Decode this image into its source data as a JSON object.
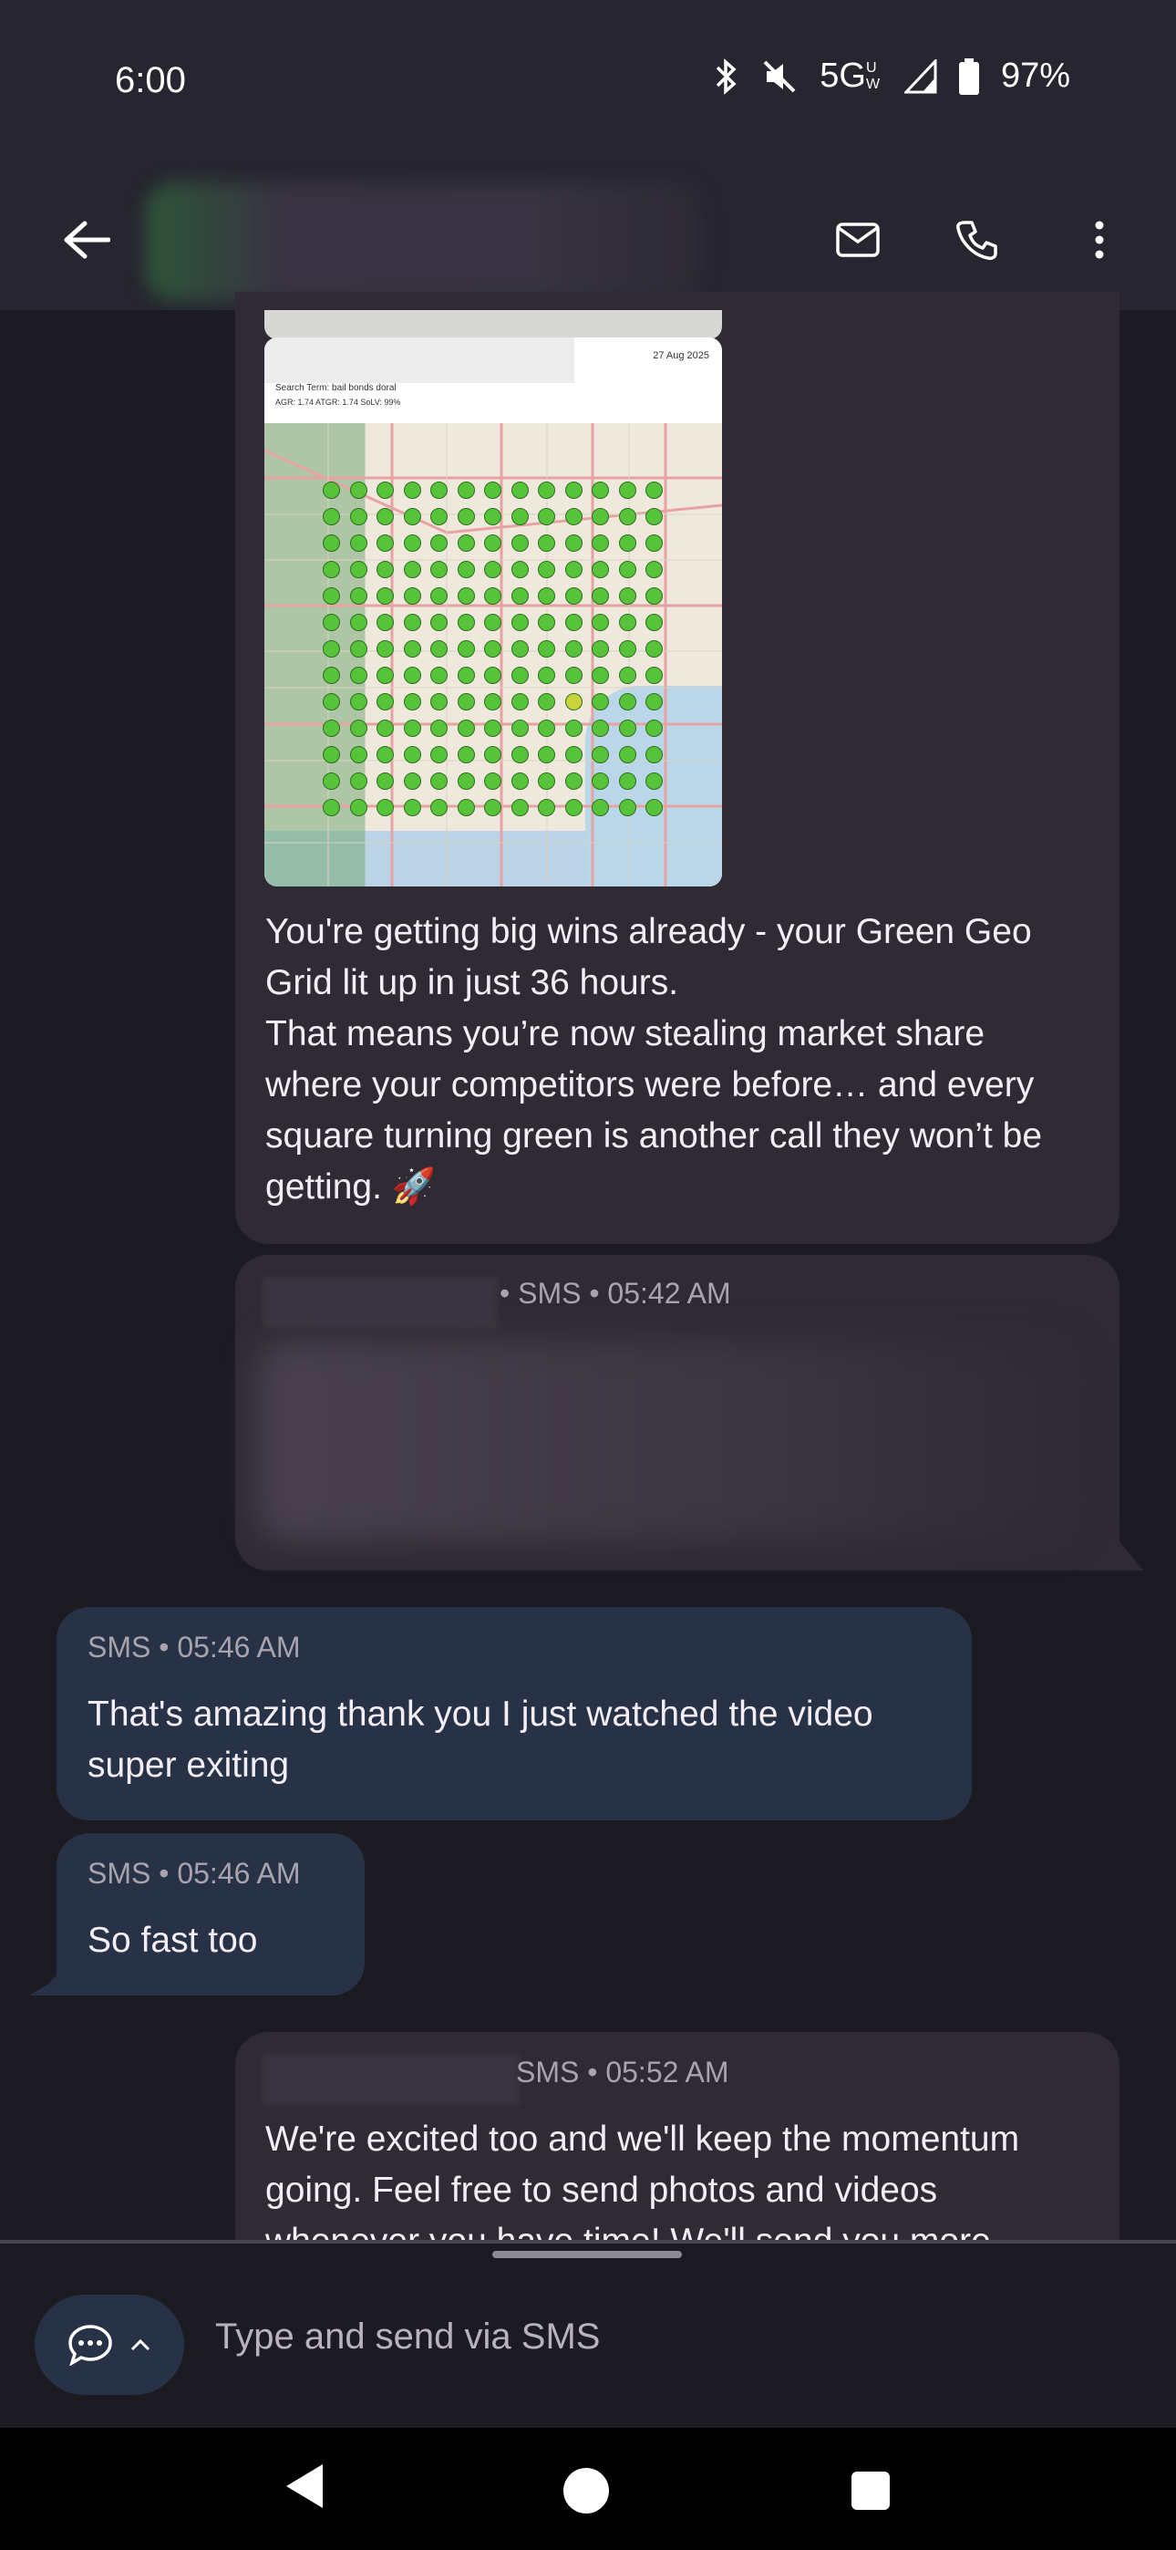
{
  "status_bar": {
    "time": "6:00",
    "network": "5G",
    "network_sub": "UW",
    "battery": "97%",
    "icons": [
      "bluetooth-icon",
      "vibrate-off-icon",
      "signal-icon",
      "battery-icon"
    ]
  },
  "app_bar": {
    "icons": [
      "back-arrow-icon",
      "mail-icon",
      "phone-icon",
      "more-vert-icon"
    ]
  },
  "conversation": {
    "map_image": {
      "date": "27 Aug 2025",
      "search_term": "Search Term: bail bonds doral",
      "stats": "AGR: 1.74    ATGR: 1.74    SoLV: 99%"
    },
    "message_1": {
      "text": "You're getting big wins already - your Green Geo\nGrid lit up in just 36 hours.\nThat means you’re now stealing market share\nwhere your competitors were before… and every\nsquare turning green is another call they won’t be\ngetting. 🚀"
    },
    "message_2": {
      "meta": "• SMS • 05:42 AM"
    },
    "message_3": {
      "meta": "SMS • 05:46 AM",
      "text": "That's amazing thank you I just watched the video\nsuper exiting"
    },
    "message_4": {
      "meta": "SMS • 05:46 AM",
      "text": "So fast too"
    },
    "message_5": {
      "meta": "SMS • 05:52 AM",
      "text": "We're excited too and we'll keep the momentum\ngoing. Feel free to send photos and videos\nwhenever you have time! We'll send you more"
    }
  },
  "composer": {
    "placeholder": "Type and send via SMS",
    "icons": [
      "chat-bubble-icon",
      "chevron-up-icon"
    ]
  },
  "nav_bar": {
    "icons": [
      "nav-back-icon",
      "nav-home-icon",
      "nav-recents-icon"
    ]
  },
  "colors": {
    "background": "#1d1b22",
    "bar": "#262530",
    "bubble_sent": "#2f2a33",
    "bubble_received": "#283247",
    "map_pin": "#56c33b"
  }
}
